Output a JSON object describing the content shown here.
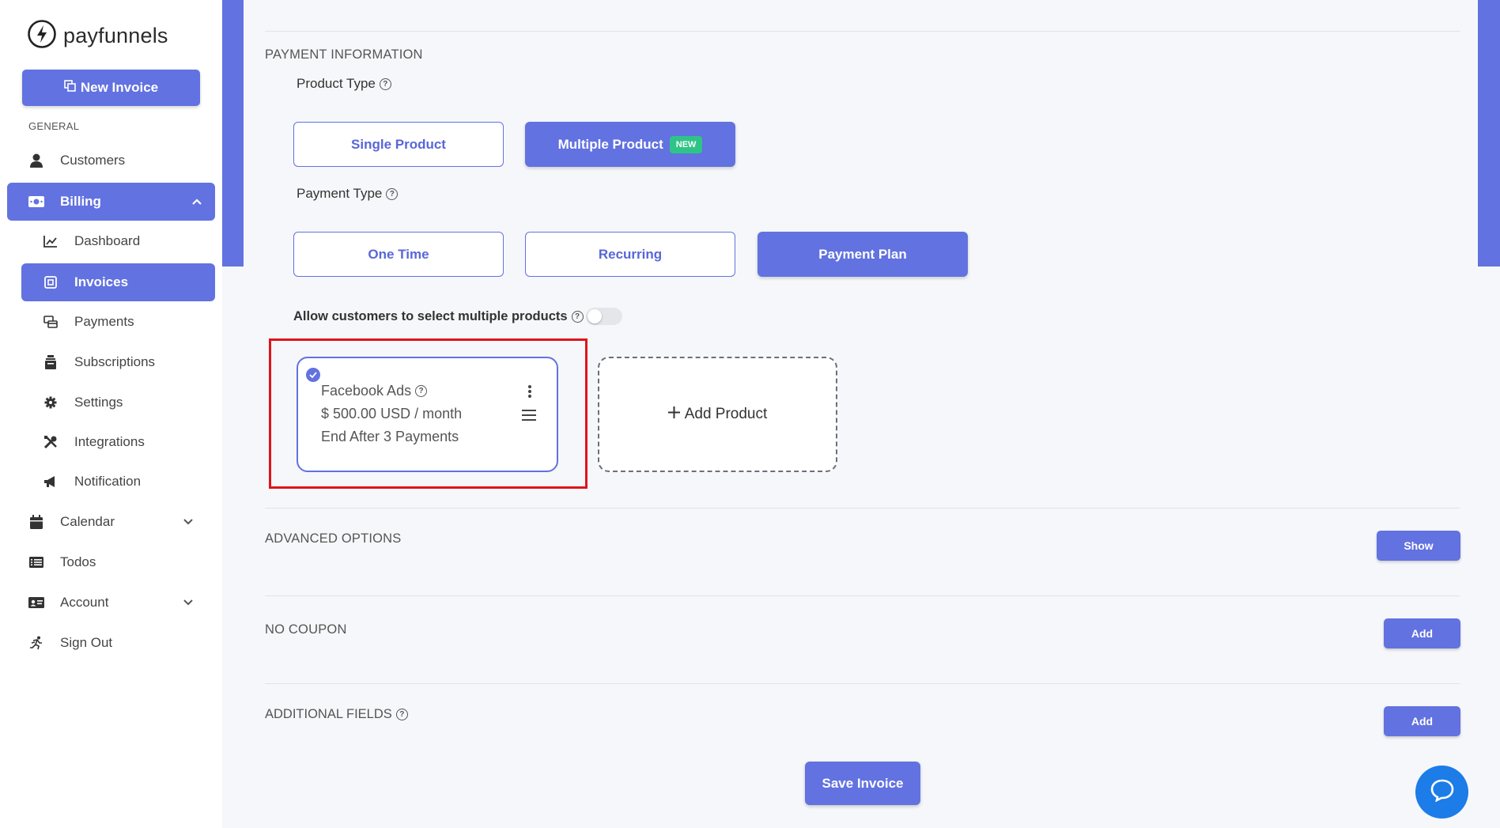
{
  "brand": {
    "name": "payfunnels"
  },
  "sidebar": {
    "new_invoice_label": "New Invoice",
    "section_general": "GENERAL",
    "items": {
      "customers": "Customers",
      "billing": "Billing",
      "dashboard": "Dashboard",
      "invoices": "Invoices",
      "payments": "Payments",
      "subscriptions": "Subscriptions",
      "settings": "Settings",
      "integrations": "Integrations",
      "notification": "Notification",
      "calendar": "Calendar",
      "todos": "Todos",
      "account": "Account",
      "sign_out": "Sign Out"
    }
  },
  "payment_info": {
    "heading": "PAYMENT INFORMATION",
    "product_type_label": "Product Type",
    "single_product": "Single Product",
    "multiple_product": "Multiple Product",
    "new_badge": "NEW",
    "payment_type_label": "Payment Type",
    "one_time": "One Time",
    "recurring": "Recurring",
    "payment_plan": "Payment Plan",
    "allow_multiple_label": "Allow customers to select multiple products",
    "allow_multiple_enabled": false
  },
  "product_card": {
    "name": "Facebook Ads",
    "price": "$ 500.00 USD / month",
    "end": "End After 3 Payments"
  },
  "add_product_label": "Add Product",
  "advanced_options": {
    "label": "ADVANCED OPTIONS",
    "button": "Show"
  },
  "coupon": {
    "label": "NO COUPON",
    "button": "Add"
  },
  "additional_fields": {
    "label": "ADDITIONAL FIELDS",
    "button": "Add"
  },
  "save_invoice_label": "Save Invoice",
  "colors": {
    "accent": "#6272e0",
    "badge_green": "#2fc487",
    "highlight_red": "#e0141c",
    "chat_blue": "#1c7ce8"
  }
}
